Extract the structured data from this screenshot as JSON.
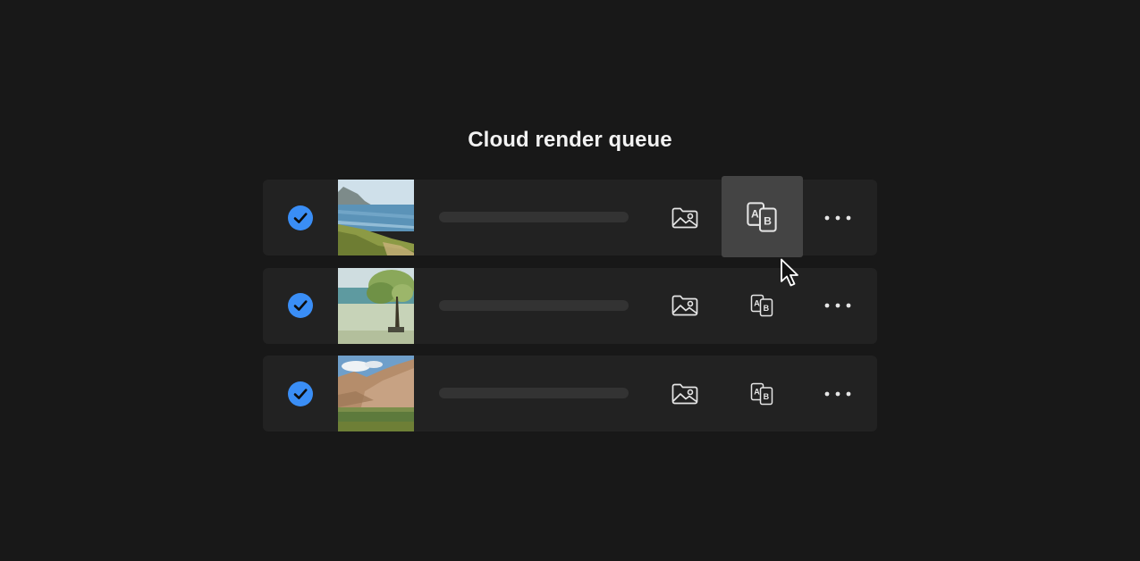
{
  "title": "Cloud render queue",
  "accent_color": "#3a8ef6",
  "rows": [
    {
      "status": "checked",
      "status_icon": "check-circle-icon",
      "thumbnail": "coastline-cliff-ocean",
      "name_placeholder": "loading-bar",
      "actions": [
        "image-folder-icon",
        "ab-compare-icon",
        "more-icon"
      ],
      "hovered_action": "ab-compare-icon"
    },
    {
      "status": "checked",
      "status_icon": "check-circle-icon",
      "thumbnail": "tree-in-field",
      "name_placeholder": "loading-bar",
      "actions": [
        "image-folder-icon",
        "ab-compare-icon",
        "more-icon"
      ]
    },
    {
      "status": "checked",
      "status_icon": "check-circle-icon",
      "thumbnail": "desert-hills-green-field",
      "name_placeholder": "loading-bar",
      "actions": [
        "image-folder-icon",
        "ab-compare-icon",
        "more-icon"
      ]
    }
  ],
  "cursor": "arrow-cursor-icon"
}
